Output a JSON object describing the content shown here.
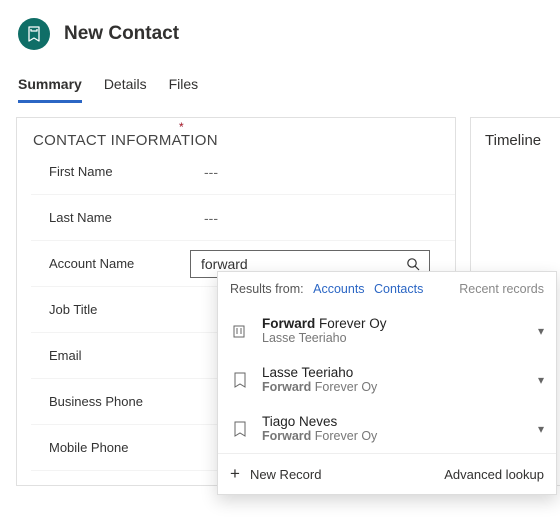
{
  "header": {
    "title": "New Contact"
  },
  "tabs": [
    {
      "label": "Summary",
      "active": true
    },
    {
      "label": "Details",
      "active": false
    },
    {
      "label": "Files",
      "active": false
    }
  ],
  "card": {
    "title": "CONTACT INFORMATION",
    "fields": {
      "first_name": {
        "label": "First Name",
        "value": "---",
        "indicator": "blue"
      },
      "last_name": {
        "label": "Last Name",
        "value": "---",
        "indicator": "red"
      },
      "account_name": {
        "label": "Account Name",
        "value": "forward"
      },
      "job_title": {
        "label": "Job Title",
        "value": ""
      },
      "email": {
        "label": "Email",
        "value": ""
      },
      "business_phone": {
        "label": "Business Phone",
        "value": ""
      },
      "mobile_phone": {
        "label": "Mobile Phone",
        "value": ""
      }
    }
  },
  "side": {
    "title": "Timeline"
  },
  "lookup": {
    "results_from_label": "Results from:",
    "results_from_links": {
      "accounts": "Accounts",
      "contacts": "Contacts"
    },
    "recent_label": "Recent records",
    "results": [
      {
        "type": "account",
        "line1_bold": "Forward",
        "line1_rest": " Forever Oy",
        "line2": "Lasse Teeriaho"
      },
      {
        "type": "contact",
        "line1": "Lasse Teeriaho",
        "line2_bold": "Forward",
        "line2_rest": " Forever Oy"
      },
      {
        "type": "contact",
        "line1": "Tiago Neves",
        "line2_bold": "Forward",
        "line2_rest": " Forever Oy"
      }
    ],
    "footer": {
      "new_record": "New Record",
      "advanced": "Advanced lookup"
    }
  }
}
